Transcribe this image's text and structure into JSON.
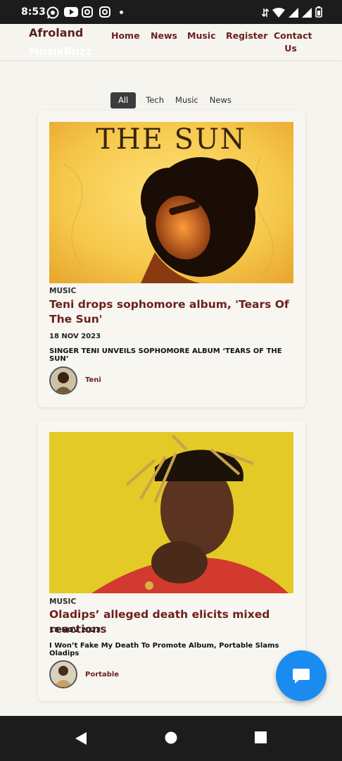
{
  "status_bar": {
    "time": "8:53"
  },
  "header": {
    "brand_line1": "Afroland",
    "brand_line2": "MuzikBuzz",
    "nav": [
      "Home",
      "News",
      "Music",
      "Register",
      "Contact Us"
    ]
  },
  "filters": [
    "All",
    "Tech",
    "Music",
    "News"
  ],
  "active_filter": "All",
  "posts": [
    {
      "image_text": "THE SUN",
      "category": "MUSIC",
      "title": "Teni drops sophomore album, 'Tears Of The Sun'",
      "date": "18 NOV 2023",
      "excerpt": "SINGER TENI UNVEILS SOPHOMORE ALBUM ‘TEARS OF THE SUN’",
      "author": "Teni"
    },
    {
      "category": "MUSIC",
      "title": "Oladips’ alleged death elicits mixed reactions",
      "date": "18 NOV 2023",
      "excerpt": "I Won’t Fake My Death To Promote Album, Portable Slams Oladips",
      "author": "Portable"
    }
  ],
  "colors": {
    "accent": "#6b1f1f",
    "fab": "#1a8cf0",
    "background": "#f6f4ee"
  }
}
